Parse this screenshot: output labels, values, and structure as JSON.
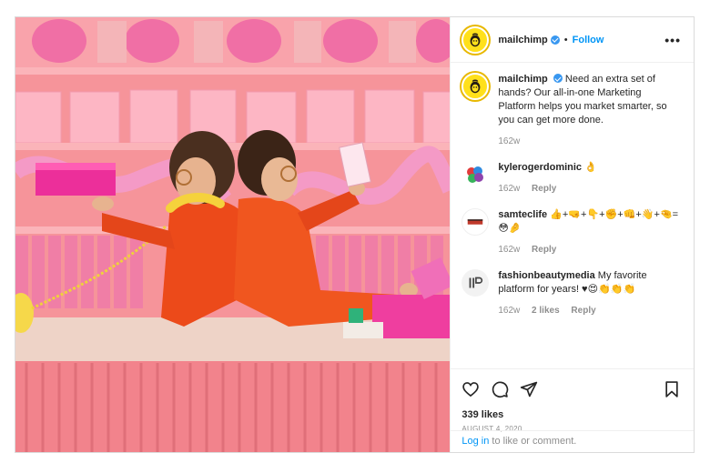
{
  "post": {
    "username": "mailchimp",
    "dot": "•",
    "follow": "Follow",
    "more": "•••",
    "caption": "Need an extra set of hands? Our all-in-one Marketing Platform helps you market smarter, so you can get more done.",
    "caption_age": "162w"
  },
  "comments": [
    {
      "user": "kylerogerdominic",
      "text": "👌",
      "age": "162w",
      "likes": "",
      "reply": "Reply"
    },
    {
      "user": "samteclife",
      "text": "👍+🤜+👇+✊+👊+👋+🤏= 😳🤌",
      "age": "162w",
      "likes": "",
      "reply": "Reply"
    },
    {
      "user": "fashionbeautymedia",
      "text": "My favorite platform for years! ♥😍👏👏👏",
      "age": "162w",
      "likes": "2 likes",
      "reply": "Reply"
    }
  ],
  "actions": {
    "likes": "339 likes",
    "date": "AUGUST 4, 2020"
  },
  "login": {
    "link": "Log in",
    "rest": " to like or comment."
  },
  "icons": {
    "like": "heart-icon",
    "comment": "comment-icon",
    "share": "share-icon",
    "save": "bookmark-icon",
    "verified": "verified-badge-icon"
  },
  "colors": {
    "accent": "#0095f6",
    "brand": "#ffe01b",
    "photo_bg": "#f58a90"
  }
}
